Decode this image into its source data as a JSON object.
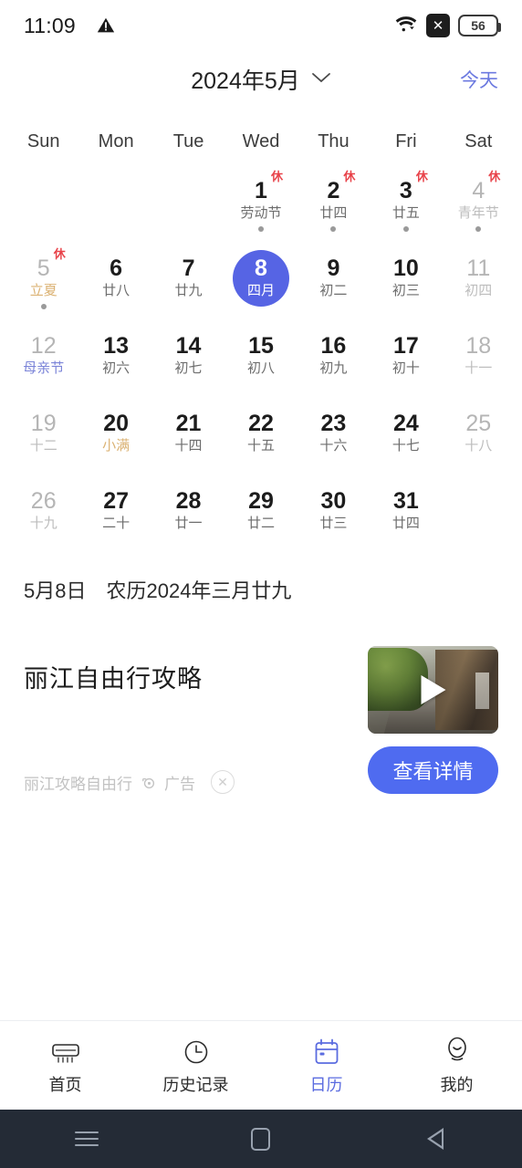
{
  "status_bar": {
    "time": "11:09",
    "warning_icon": "warning-triangle-icon",
    "wifi_icon": "wifi-icon",
    "signal_badge_icon": "no-signal-x-icon",
    "battery_level": "56"
  },
  "header": {
    "title": "2024年5月",
    "chevron_icon": "chevron-down-icon",
    "today_label": "今天",
    "accent_color": "#6c7ae0"
  },
  "calendar": {
    "weekdays": [
      "Sun",
      "Mon",
      "Tue",
      "Wed",
      "Thu",
      "Fri",
      "Sat"
    ],
    "selected_color": "#5664e4",
    "rest_badge": "休",
    "weeks": [
      [
        {
          "day": "",
          "lunar": ""
        },
        {
          "day": "",
          "lunar": ""
        },
        {
          "day": "",
          "lunar": ""
        },
        {
          "day": "1",
          "lunar": "劳动节",
          "rest": true,
          "dot": true,
          "lunar_style": "fest"
        },
        {
          "day": "2",
          "lunar": "廿四",
          "rest": true,
          "dot": true
        },
        {
          "day": "3",
          "lunar": "廿五",
          "rest": true,
          "dot": true
        },
        {
          "day": "4",
          "lunar": "青年节",
          "rest": true,
          "dot": true,
          "dim": true,
          "lunar_style": "fest"
        }
      ],
      [
        {
          "day": "5",
          "lunar": "立夏",
          "rest": true,
          "dot": true,
          "dim": true,
          "lunar_style": "term"
        },
        {
          "day": "6",
          "lunar": "廿八"
        },
        {
          "day": "7",
          "lunar": "廿九"
        },
        {
          "day": "8",
          "lunar": "四月",
          "selected": true
        },
        {
          "day": "9",
          "lunar": "初二"
        },
        {
          "day": "10",
          "lunar": "初三"
        },
        {
          "day": "11",
          "lunar": "初四",
          "dim": true
        }
      ],
      [
        {
          "day": "12",
          "lunar": "母亲节",
          "dim": true,
          "lunar_style": "fest-blue"
        },
        {
          "day": "13",
          "lunar": "初六"
        },
        {
          "day": "14",
          "lunar": "初七"
        },
        {
          "day": "15",
          "lunar": "初八"
        },
        {
          "day": "16",
          "lunar": "初九"
        },
        {
          "day": "17",
          "lunar": "初十"
        },
        {
          "day": "18",
          "lunar": "十一",
          "dim": true
        }
      ],
      [
        {
          "day": "19",
          "lunar": "十二",
          "dim": true
        },
        {
          "day": "20",
          "lunar": "小满",
          "lunar_style": "term"
        },
        {
          "day": "21",
          "lunar": "十四"
        },
        {
          "day": "22",
          "lunar": "十五"
        },
        {
          "day": "23",
          "lunar": "十六"
        },
        {
          "day": "24",
          "lunar": "十七"
        },
        {
          "day": "25",
          "lunar": "十八",
          "dim": true
        }
      ],
      [
        {
          "day": "26",
          "lunar": "十九",
          "dim": true
        },
        {
          "day": "27",
          "lunar": "二十"
        },
        {
          "day": "28",
          "lunar": "廿一"
        },
        {
          "day": "29",
          "lunar": "廿二"
        },
        {
          "day": "30",
          "lunar": "廿三"
        },
        {
          "day": "31",
          "lunar": "廿四"
        },
        {
          "day": "",
          "lunar": ""
        }
      ]
    ]
  },
  "date_detail": {
    "solar": "5月8日",
    "lunar": "农历2024年三月廿九"
  },
  "ad": {
    "title": "丽江自由行攻略",
    "source": "丽江攻略自由行",
    "ad_label": "广告",
    "info_icon": "ad-info-icon",
    "close_icon": "close-icon",
    "play_icon": "play-icon",
    "cta_label": "查看详情",
    "cta_color": "#4f6bf0"
  },
  "bottom_nav": {
    "items": [
      {
        "label": "首页",
        "icon": "air-conditioner-icon",
        "active": false
      },
      {
        "label": "历史记录",
        "icon": "clock-icon",
        "active": false
      },
      {
        "label": "日历",
        "icon": "calendar-icon",
        "active": true
      },
      {
        "label": "我的",
        "icon": "person-icon",
        "active": false
      }
    ],
    "active_color": "#5b6ce0"
  },
  "android_nav": {
    "recents_icon": "recents-menu-icon",
    "home_icon": "home-square-icon",
    "back_icon": "back-triangle-icon"
  }
}
